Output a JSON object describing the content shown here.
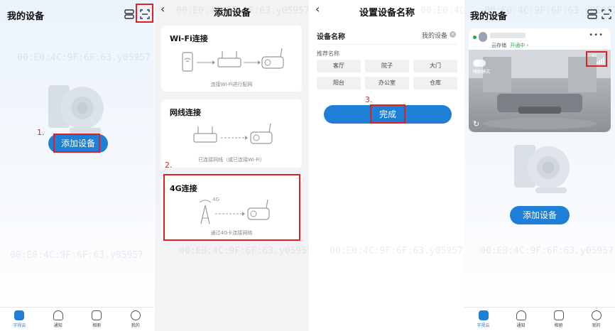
{
  "watermark": "00:E0:4C:9F:6F:63.y05957",
  "panel1": {
    "title": "我的设备",
    "step": "1.",
    "add_button": "添加设备"
  },
  "panel2": {
    "title": "添加设备",
    "wifi": {
      "title": "Wi-Fi连接",
      "caption": "连接Wi-Fi进行配网"
    },
    "wired": {
      "title": "网线连接",
      "caption": "已连接网线（或已连接Wi-Fi）"
    },
    "step": "2.",
    "fourg": {
      "title": "4G连接",
      "signal_label": "4G",
      "caption": "通过4G卡连接网络"
    }
  },
  "panel3": {
    "title": "设置设备名称",
    "name_label": "设备名称",
    "name_value": "我的设备",
    "recommend_label": "推荐名称",
    "chips": [
      "客厅",
      "院子",
      "大门",
      "阳台",
      "办公室",
      "仓库"
    ],
    "step": "3.",
    "done_button": "完成"
  },
  "panel4": {
    "title": "我的设备",
    "cloud_label": "云存储",
    "cloud_status": "开通中",
    "mode_label": "睡眠模式",
    "add_button": "添加设备",
    "signal_label": "4G"
  },
  "tabs": [
    "字视云",
    "通知",
    "相册",
    "我的"
  ],
  "colors": {
    "accent": "#1f7fd6",
    "annotation": "#e02020",
    "cloud_status": "#2aa84a"
  }
}
